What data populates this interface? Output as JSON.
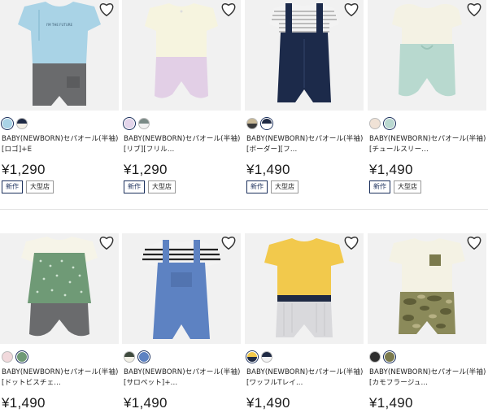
{
  "products": [
    {
      "title1": "BABY(NEWBORN)セパオール(半袖)",
      "title2": "[ロゴ]+E",
      "price": "¥1,290",
      "badges": [
        "新作",
        "大型店"
      ],
      "swatches": [
        {
          "c1": "#a9d3e6",
          "sel": true
        },
        {
          "c1": "#1f2a44",
          "c2": "#f4f0e6"
        }
      ]
    },
    {
      "title1": "BABY(NEWBORN)セパオール(半袖)",
      "title2": "[リブ][フリル...",
      "price": "¥1,290",
      "badges": [
        "新作",
        "大型店"
      ],
      "swatches": [
        {
          "c1": "#e3d4ea",
          "sel": true
        },
        {
          "c1": "#7a8a86",
          "c2": "#f2f2f2"
        }
      ]
    },
    {
      "title1": "BABY(NEWBORN)セパオール(半袖)",
      "title2": "[ボーダー][フ...",
      "price": "¥1,490",
      "badges": [
        "新作",
        "大型店"
      ],
      "swatches": [
        {
          "c1": "#c8b896",
          "c2": "#3a3a3a"
        },
        {
          "c1": "#1f2a44",
          "c2": "#ffffff",
          "sel": true
        }
      ]
    },
    {
      "title1": "BABY(NEWBORN)セパオール(半袖)",
      "title2": "[チュールスリー...",
      "price": "¥1,490",
      "badges": [
        "新作",
        "大型店"
      ],
      "swatches": [
        {
          "c1": "#f0e2d6"
        },
        {
          "c1": "#b9d8d0",
          "sel": true
        }
      ]
    },
    {
      "title1": "BABY(NEWBORN)セパオール(半袖)",
      "title2": "[ドットビスチェ...",
      "price": "¥1,490",
      "badges": [],
      "swatches": [
        {
          "c1": "#f1d9dc"
        },
        {
          "c1": "#6f9a76",
          "sel": true
        }
      ]
    },
    {
      "title1": "BABY(NEWBORN)セパオール(半袖)",
      "title2": "[サロペット]+...",
      "price": "¥1,490",
      "badges": [],
      "swatches": [
        {
          "c1": "#3f4a3d",
          "c2": "#f2f0e6"
        },
        {
          "c1": "#5d82c2",
          "sel": true
        }
      ]
    },
    {
      "title1": "BABY(NEWBORN)セパオール(半袖)",
      "title2": "[ワッフルTレイ...",
      "price": "¥1,490",
      "badges": [],
      "swatches": [
        {
          "c1": "#f2c94c",
          "c2": "#1f2a44",
          "sel": true
        },
        {
          "c1": "#1f2a44",
          "c2": "#f3f3f3"
        }
      ]
    },
    {
      "title1": "BABY(NEWBORN)セパオール(半袖)",
      "title2": "[カモフラージュ...",
      "price": "¥1,490",
      "badges": [],
      "swatches": [
        {
          "c1": "#2e2e2e"
        },
        {
          "c1": "#7b7a4d",
          "sel": true
        }
      ]
    }
  ],
  "icons": {
    "favorite": "heart-outline-icon"
  },
  "colors": {
    "badge_new": "#1a2f5c",
    "badge_store": "#999999"
  }
}
